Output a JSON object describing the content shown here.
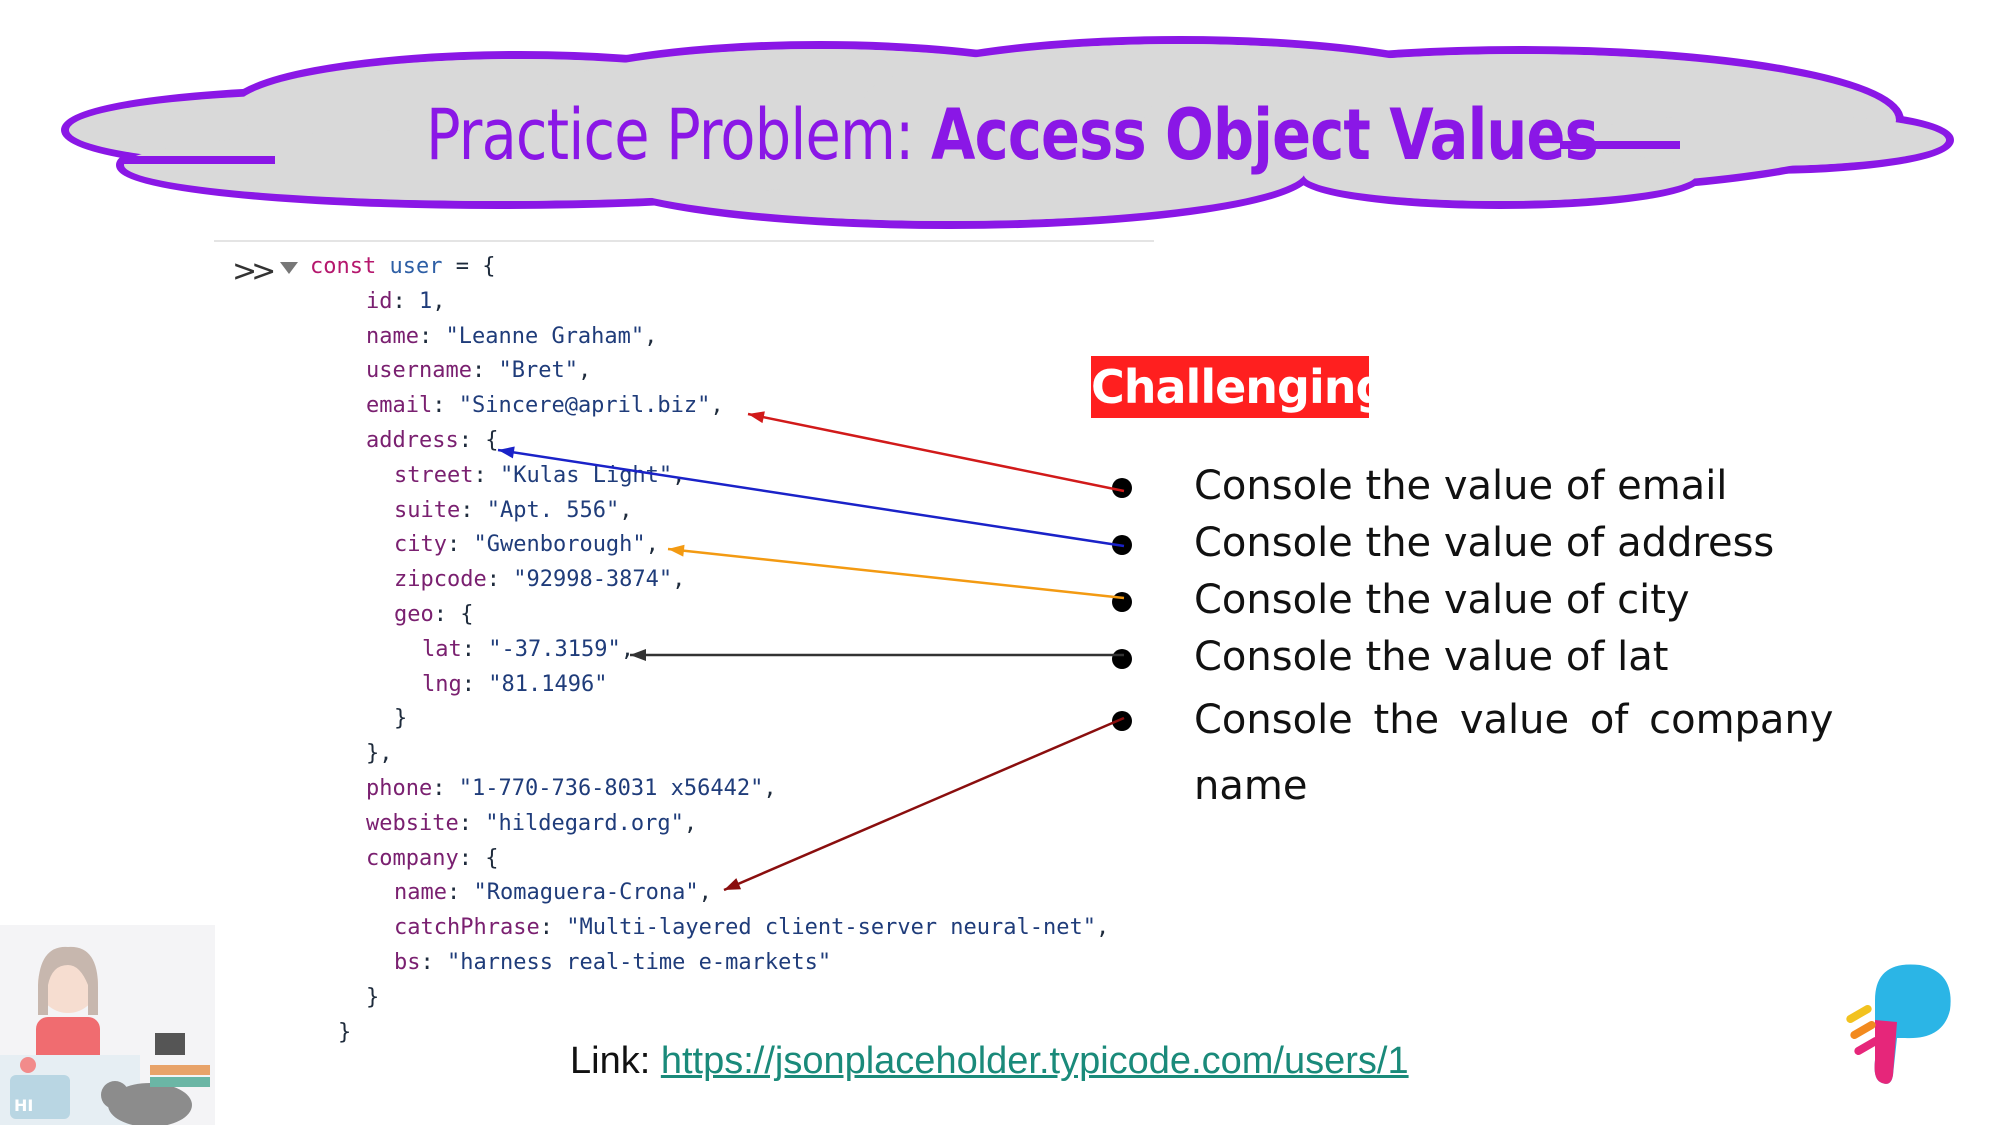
{
  "title": {
    "prefix": "Practice Problem: ",
    "main": "Access Object Values"
  },
  "badge": "Challenging",
  "code_lines": [
    {
      "parts": [
        {
          "t": "const ",
          "c": "kw"
        },
        {
          "t": "user",
          "c": "var"
        },
        {
          "t": " = {",
          "c": ""
        }
      ]
    },
    {
      "parts": [
        {
          "t": "id",
          "c": "key"
        },
        {
          "t": ": ",
          "c": ""
        },
        {
          "t": "1",
          "c": "num"
        },
        {
          "t": ",",
          "c": ""
        }
      ]
    },
    {
      "parts": [
        {
          "t": "name",
          "c": "key"
        },
        {
          "t": ": ",
          "c": ""
        },
        {
          "t": "\"Leanne Graham\"",
          "c": "str"
        },
        {
          "t": ",",
          "c": ""
        }
      ]
    },
    {
      "parts": [
        {
          "t": "username",
          "c": "key"
        },
        {
          "t": ": ",
          "c": ""
        },
        {
          "t": "\"Bret\"",
          "c": "str"
        },
        {
          "t": ",",
          "c": ""
        }
      ]
    },
    {
      "parts": [
        {
          "t": "email",
          "c": "key"
        },
        {
          "t": ": ",
          "c": ""
        },
        {
          "t": "\"Sincere@april.biz\"",
          "c": "str"
        },
        {
          "t": ",",
          "c": ""
        }
      ]
    },
    {
      "parts": [
        {
          "t": "address",
          "c": "key"
        },
        {
          "t": ": {",
          "c": ""
        }
      ]
    },
    {
      "parts": [
        {
          "t": "street",
          "c": "key"
        },
        {
          "t": ": ",
          "c": ""
        },
        {
          "t": "\"Kulas Light\"",
          "c": "str"
        },
        {
          "t": ",",
          "c": ""
        }
      ]
    },
    {
      "parts": [
        {
          "t": "suite",
          "c": "key"
        },
        {
          "t": ": ",
          "c": ""
        },
        {
          "t": "\"Apt. 556\"",
          "c": "str"
        },
        {
          "t": ",",
          "c": ""
        }
      ]
    },
    {
      "parts": [
        {
          "t": "city",
          "c": "key"
        },
        {
          "t": ": ",
          "c": ""
        },
        {
          "t": "\"Gwenborough\"",
          "c": "str"
        },
        {
          "t": ",",
          "c": ""
        }
      ]
    },
    {
      "parts": [
        {
          "t": "zipcode",
          "c": "key"
        },
        {
          "t": ": ",
          "c": ""
        },
        {
          "t": "\"92998-3874\"",
          "c": "str"
        },
        {
          "t": ",",
          "c": ""
        }
      ]
    },
    {
      "parts": [
        {
          "t": "geo",
          "c": "key"
        },
        {
          "t": ": {",
          "c": ""
        }
      ]
    },
    {
      "parts": [
        {
          "t": "lat",
          "c": "key"
        },
        {
          "t": ": ",
          "c": ""
        },
        {
          "t": "\"-37.3159\"",
          "c": "str"
        },
        {
          "t": ",",
          "c": ""
        }
      ]
    },
    {
      "parts": [
        {
          "t": "lng",
          "c": "key"
        },
        {
          "t": ": ",
          "c": ""
        },
        {
          "t": "\"81.1496\"",
          "c": "str"
        }
      ]
    },
    {
      "parts": [
        {
          "t": "}",
          "c": ""
        }
      ]
    },
    {
      "parts": [
        {
          "t": "},",
          "c": ""
        }
      ]
    },
    {
      "parts": [
        {
          "t": "phone",
          "c": "key"
        },
        {
          "t": ": ",
          "c": ""
        },
        {
          "t": "\"1-770-736-8031 x56442\"",
          "c": "str"
        },
        {
          "t": ",",
          "c": ""
        }
      ]
    },
    {
      "parts": [
        {
          "t": "website",
          "c": "key"
        },
        {
          "t": ": ",
          "c": ""
        },
        {
          "t": "\"hildegard.org\"",
          "c": "str"
        },
        {
          "t": ",",
          "c": ""
        }
      ]
    },
    {
      "parts": [
        {
          "t": "company",
          "c": "key"
        },
        {
          "t": ": {",
          "c": ""
        }
      ]
    },
    {
      "parts": [
        {
          "t": "name",
          "c": "key"
        },
        {
          "t": ": ",
          "c": ""
        },
        {
          "t": "\"Romaguera-Crona\"",
          "c": "str"
        },
        {
          "t": ",",
          "c": ""
        }
      ]
    },
    {
      "parts": [
        {
          "t": "catchPhrase",
          "c": "key"
        },
        {
          "t": ": ",
          "c": ""
        },
        {
          "t": "\"Multi-layered client-server neural-net\"",
          "c": "str"
        },
        {
          "t": ",",
          "c": ""
        }
      ]
    },
    {
      "parts": [
        {
          "t": "bs",
          "c": "key"
        },
        {
          "t": ": ",
          "c": ""
        },
        {
          "t": "\"harness real-time e-markets\"",
          "c": "str"
        }
      ]
    },
    {
      "parts": [
        {
          "t": "}",
          "c": ""
        }
      ]
    },
    {
      "parts": [
        {
          "t": "}",
          "c": ""
        }
      ]
    }
  ],
  "tasks": [
    {
      "text": "Console the value of email",
      "arrow_color": "#d11a1a"
    },
    {
      "text": "Console the value of address",
      "arrow_color": "#1a22c8"
    },
    {
      "text": "Console the value of city",
      "arrow_color": "#f39a12"
    },
    {
      "text": "Console the value of lat",
      "arrow_color": "#333333"
    },
    {
      "text": "Console the value of company name",
      "arrow_color": "#8a0e0e"
    }
  ],
  "link": {
    "label": "Link: ",
    "url": "https://jsonplaceholder.typicode.com/users/1"
  },
  "colors": {
    "title_purple": "#8a17e6",
    "cloud_fill": "#d9d9d9",
    "badge_red": "#ff1f1f"
  }
}
